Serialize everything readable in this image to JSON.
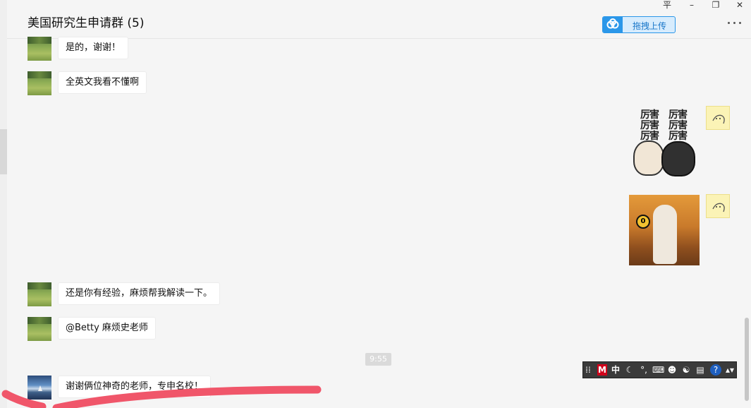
{
  "window": {
    "title": "美国研究生申请群 (5)",
    "controls": {
      "pin": "平",
      "minimize": "–",
      "maximize": "❐",
      "close": "✕"
    }
  },
  "toolbar": {
    "upload_label": "拖拽上传",
    "more_label": "更多"
  },
  "messages": [
    {
      "sender": "other",
      "avatar": "grass-avatar",
      "text": "是的，谢谢！"
    },
    {
      "sender": "other",
      "avatar": "grass-avatar",
      "text": "全英文我看不懂啊"
    },
    {
      "sender": "self",
      "avatar": "self-avatar",
      "type": "sticker",
      "sticker": "cats-sticker",
      "sticker_text": [
        "厉害",
        "厉害",
        "厉害",
        "厉害",
        "厉害",
        "厉害"
      ]
    },
    {
      "sender": "self",
      "avatar": "self-avatar",
      "type": "sticker",
      "sticker": "llama-sticker",
      "sticker_text": [
        "0"
      ]
    },
    {
      "sender": "other",
      "avatar": "grass-avatar",
      "text": "还是你有经验，麻烦帮我解读一下。"
    },
    {
      "sender": "other",
      "avatar": "grass-avatar",
      "text": "@Betty 麻烦史老师"
    },
    {
      "sender": "other",
      "avatar": "lake-avatar",
      "text": "谢谢俩位神奇的老师，专申名校！"
    }
  ],
  "timestamp": "9:55",
  "ime_toolbar": {
    "logo": "M",
    "mode": "中",
    "moon": "☾",
    "punctuation": "°,",
    "keyboard": "⌨",
    "user": "☻",
    "skin": "☯",
    "tools": "▤",
    "help": "?",
    "menu": "▴▾"
  },
  "colors": {
    "accent": "#2b97e9",
    "background": "#f5f5f5",
    "bubble": "#ffffff",
    "scribble": "#f0566a"
  }
}
